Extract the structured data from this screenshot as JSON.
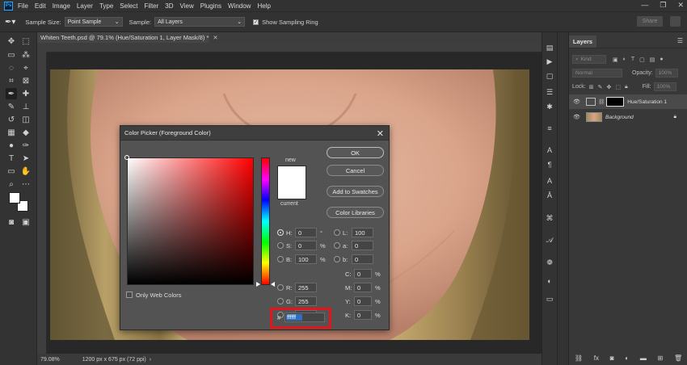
{
  "menubar": {
    "logo": "Ps",
    "items": [
      "File",
      "Edit",
      "Image",
      "Layer",
      "Type",
      "Select",
      "Filter",
      "3D",
      "View",
      "Plugins",
      "Window",
      "Help"
    ]
  },
  "options": {
    "sample_size_label": "Sample Size:",
    "sample_size_value": "Point Sample",
    "sample_label": "Sample:",
    "sample_value": "All Layers",
    "show_ring_label": "Show Sampling Ring",
    "share_label": "Share"
  },
  "document": {
    "tab_title": "Whiten Teeth.psd @ 79.1% (Hue/Saturation 1, Layer Mask/8) *",
    "zoom": "79.08%",
    "dimensions": "1200 px x 675 px (72 ppi)"
  },
  "layers_panel": {
    "tab": "Layers",
    "kind_placeholder": "Kind",
    "blend_mode": "Normal",
    "opacity_label": "Opacity:",
    "opacity_value": "100%",
    "lock_label": "Lock:",
    "fill_label": "Fill:",
    "fill_value": "100%",
    "layers": [
      {
        "name": "Hue/Saturation 1"
      },
      {
        "name": "Background"
      }
    ]
  },
  "color_picker": {
    "title": "Color Picker (Foreground Color)",
    "new_label": "new",
    "current_label": "current",
    "buttons": {
      "ok": "OK",
      "cancel": "Cancel",
      "add_swatches": "Add to Swatches",
      "libraries": "Color Libraries"
    },
    "only_web_colors": "Only Web Colors",
    "hsb": {
      "h": "0",
      "h_unit": "°",
      "s": "0",
      "s_unit": "%",
      "b": "100",
      "b_unit": "%"
    },
    "rgb": {
      "r": "255",
      "g": "255",
      "b": "255"
    },
    "lab": {
      "l": "100",
      "a": "0",
      "b": "0"
    },
    "cmyk": {
      "c": "0",
      "m": "0",
      "y": "0",
      "k": "0",
      "unit": "%"
    },
    "hex_hash": "#",
    "hex": "ffffff",
    "colors": {
      "new": "#ffffff",
      "current": "#ffffff",
      "highlight": "#e3151b"
    }
  }
}
